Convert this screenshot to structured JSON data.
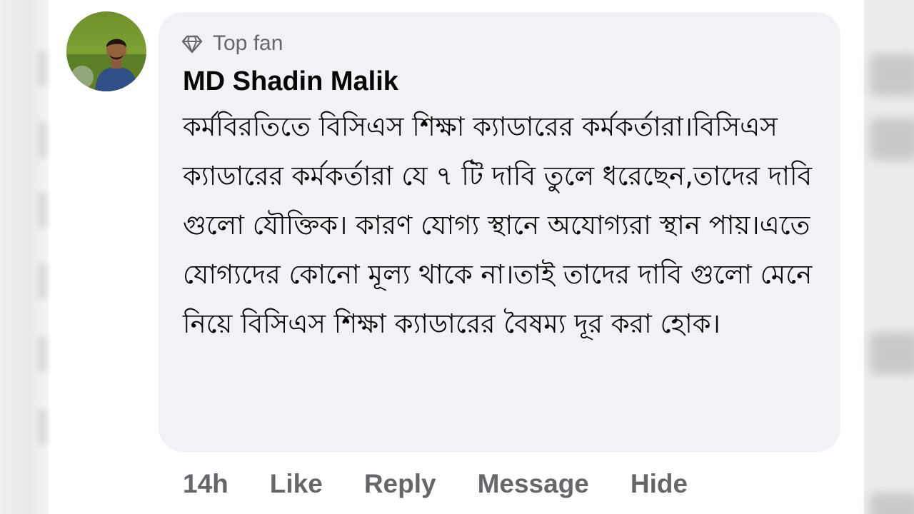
{
  "comment": {
    "badge": {
      "icon": "diamond-icon",
      "label": "Top fan"
    },
    "author": "MD Shadin Malik",
    "text": "কর্মবিরতিতে বিসিএস শিক্ষা ক্যাডারের কর্মকর্তারা।বিসিএস ক্যাডারের কর্মকর্তারা যে ৭ টি দাবি তুলে ধরেছেন,তাদের দাবি গুলো যৌক্তিক। কারণ যোগ্য স্থানে অযোগ্যরা স্থান পায়।এতে যোগ্যদের কোনো মূল্য থাকে না।তাই তাদের দাবি গুলো মেনে নিয়ে বিসিএস শিক্ষা ক্যাডারের বৈষম্য দূর করা হোক।",
    "timestamp": "14h",
    "actions": {
      "like": "Like",
      "reply": "Reply",
      "message": "Message",
      "hide": "Hide"
    }
  },
  "colors": {
    "bubble": "#f0f2f5",
    "text": "#050505",
    "secondary": "#65676b"
  }
}
